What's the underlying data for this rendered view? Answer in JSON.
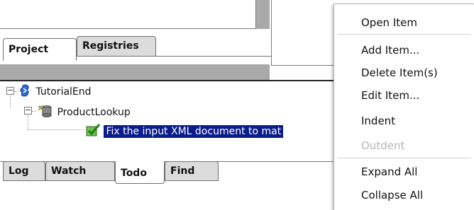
{
  "top_tabs": [
    {
      "label": "Project",
      "active": true
    },
    {
      "label": "Registries",
      "active": false
    }
  ],
  "tree": {
    "root": {
      "label": "TutorialEnd",
      "icon": "project-icon"
    },
    "child": {
      "label": "ProductLookup",
      "icon": "database-icon"
    },
    "leaf": {
      "label": "Fix the input XML document to mat",
      "icon": "todo-check-icon"
    }
  },
  "bottom_tabs": [
    {
      "label": "Log",
      "active": false
    },
    {
      "label": "Watch",
      "active": false
    },
    {
      "label": "Todo",
      "active": true
    },
    {
      "label": "Find",
      "active": false
    }
  ],
  "context_menu": {
    "items": [
      {
        "label": "Open Item",
        "enabled": true
      },
      {
        "label": "Add Item...",
        "enabled": true
      },
      {
        "label": "Delete Item(s)",
        "enabled": true
      },
      {
        "label": "Edit Item...",
        "enabled": true
      },
      {
        "label": "Indent",
        "enabled": true
      },
      {
        "label": "Outdent",
        "enabled": false
      },
      {
        "label": "Expand All",
        "enabled": true
      },
      {
        "label": "Collapse All",
        "enabled": true
      }
    ]
  },
  "colors": {
    "selection": "#0a1d8a",
    "panel_gray": "#a9a9a9"
  }
}
